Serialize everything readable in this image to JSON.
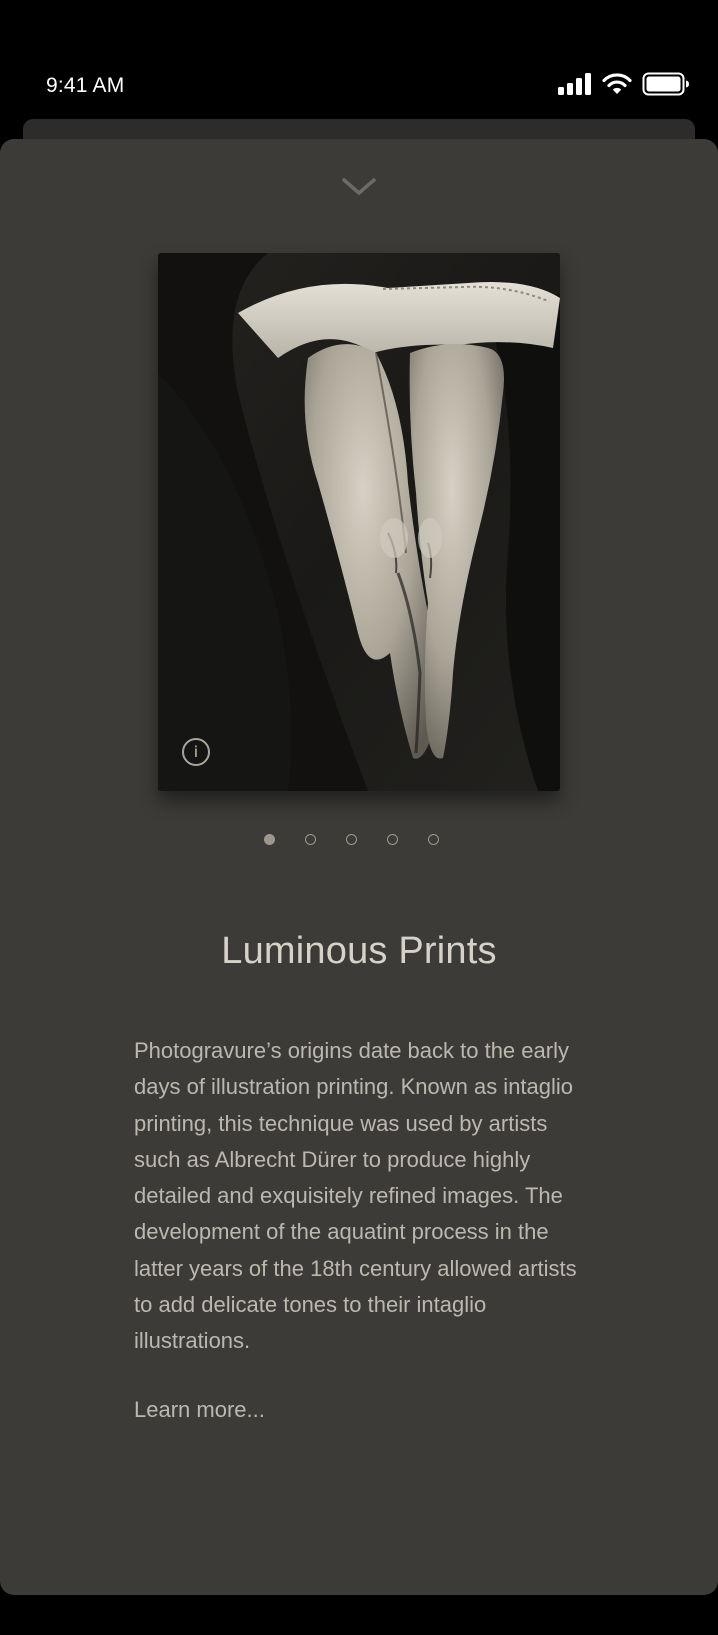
{
  "status_bar": {
    "time": "9:41 AM"
  },
  "sheet": {
    "collapse_icon": "chevron-down-icon"
  },
  "artwork": {
    "info_label": "i",
    "info_icon": "info-icon"
  },
  "pager": {
    "count": 5,
    "active_index": 0
  },
  "content": {
    "title": "Luminous Prints",
    "body": "Photogravure’s origins date back to the early days of illustration printing. Known as intaglio printing, this technique was used by artists such as Albrecht Dürer to produce highly detailed and exquisitely refined images. The development of the aquatint process in the latter years of the 18th century allowed artists to add delicate tones to their intaglio illustrations.",
    "link": "Learn more..."
  },
  "colors": {
    "sheet_background": "#3d3b38",
    "title_text": "#d6d2c8",
    "body_text": "#bcb8ae"
  }
}
